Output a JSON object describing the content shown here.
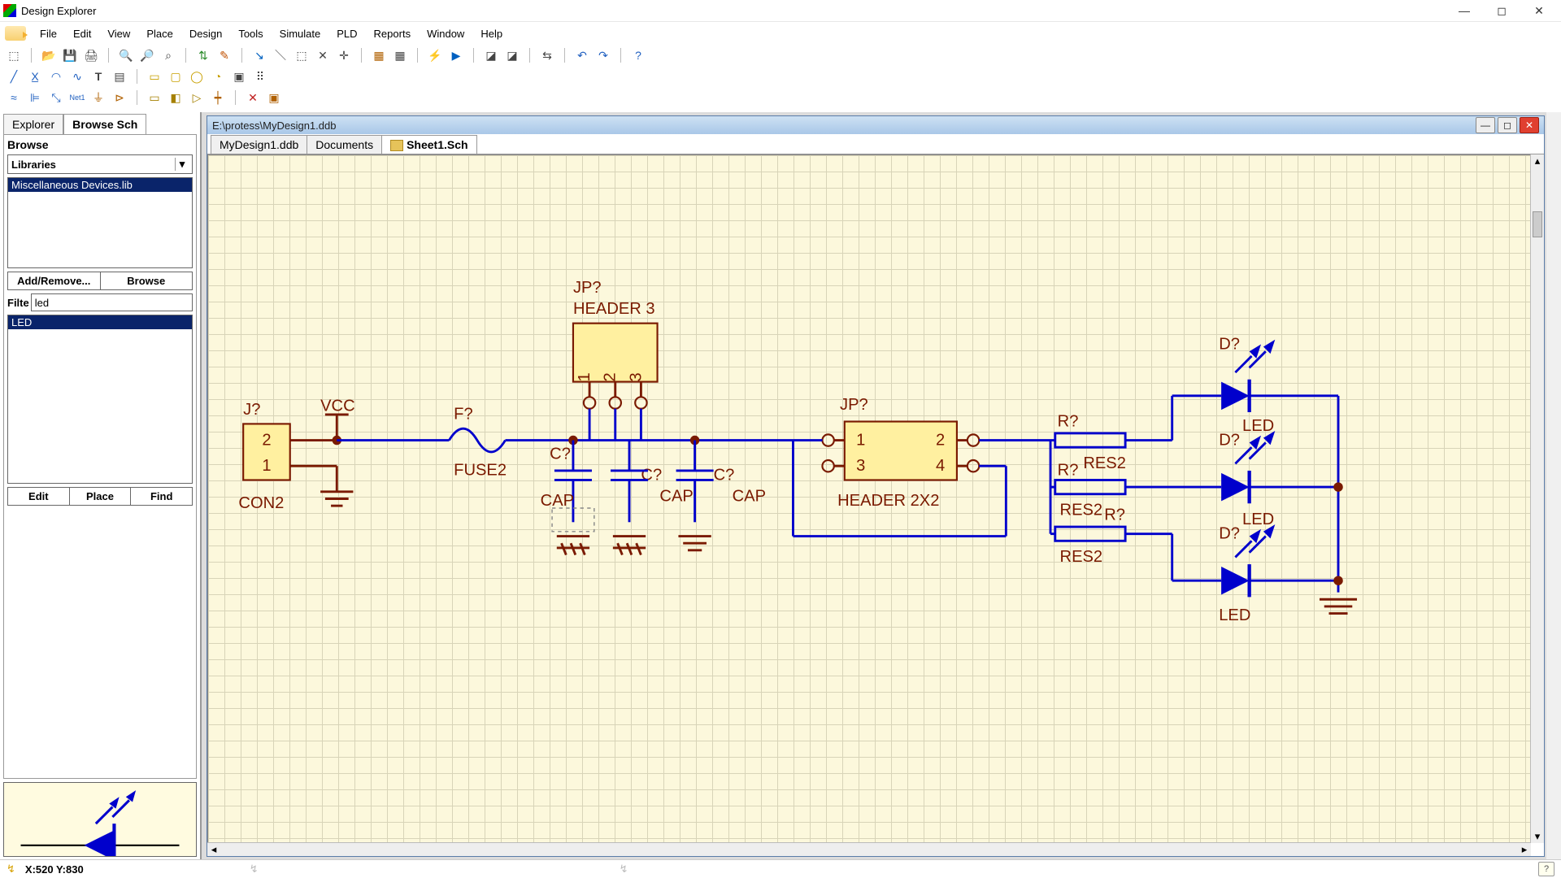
{
  "window": {
    "title": "Design Explorer"
  },
  "menu": [
    "File",
    "Edit",
    "View",
    "Place",
    "Design",
    "Tools",
    "Simulate",
    "PLD",
    "Reports",
    "Window",
    "Help"
  ],
  "sidepanel": {
    "tabs": [
      "Explorer",
      "Browse Sch"
    ],
    "active_tab": 1,
    "browse_label": "Browse",
    "combo_value": "Libraries",
    "lib_list": [
      "Miscellaneous Devices.lib"
    ],
    "add_remove": "Add/Remove...",
    "browse_btn": "Browse",
    "filter_label": "Filte",
    "filter_value": "led",
    "part_list": [
      "LED"
    ],
    "edit_btn": "Edit",
    "place_btn": "Place",
    "find_btn": "Find"
  },
  "document": {
    "path": "E:\\protess\\MyDesign1.ddb",
    "tabs": [
      "MyDesign1.ddb",
      "Documents",
      "Sheet1.Sch"
    ],
    "active_tab": 2
  },
  "schematic": [
    {
      "ref": "J?",
      "value": "CON2",
      "pins": [
        "2",
        "1"
      ]
    },
    {
      "ref": "",
      "value": "VCC"
    },
    {
      "ref": "F?",
      "value": "FUSE2"
    },
    {
      "ref": "JP?",
      "value": "HEADER 3",
      "pins": [
        "1",
        "2",
        "3"
      ]
    },
    {
      "ref": "C?",
      "value": "CAP"
    },
    {
      "ref": "C?",
      "value": "CAP"
    },
    {
      "ref": "C?",
      "value": "CAP"
    },
    {
      "ref": "JP?",
      "value": "HEADER 2X2",
      "pins": [
        "1",
        "2",
        "3",
        "4"
      ]
    },
    {
      "ref": "R?",
      "value": "RES2"
    },
    {
      "ref": "R?",
      "value": "RES2"
    },
    {
      "ref": "R?",
      "value": "RES2"
    },
    {
      "ref": "D?",
      "value": "LED"
    },
    {
      "ref": "D?",
      "value": "LED"
    },
    {
      "ref": "D?",
      "value": "LED"
    }
  ],
  "status": {
    "coords": "X:520 Y:830"
  }
}
